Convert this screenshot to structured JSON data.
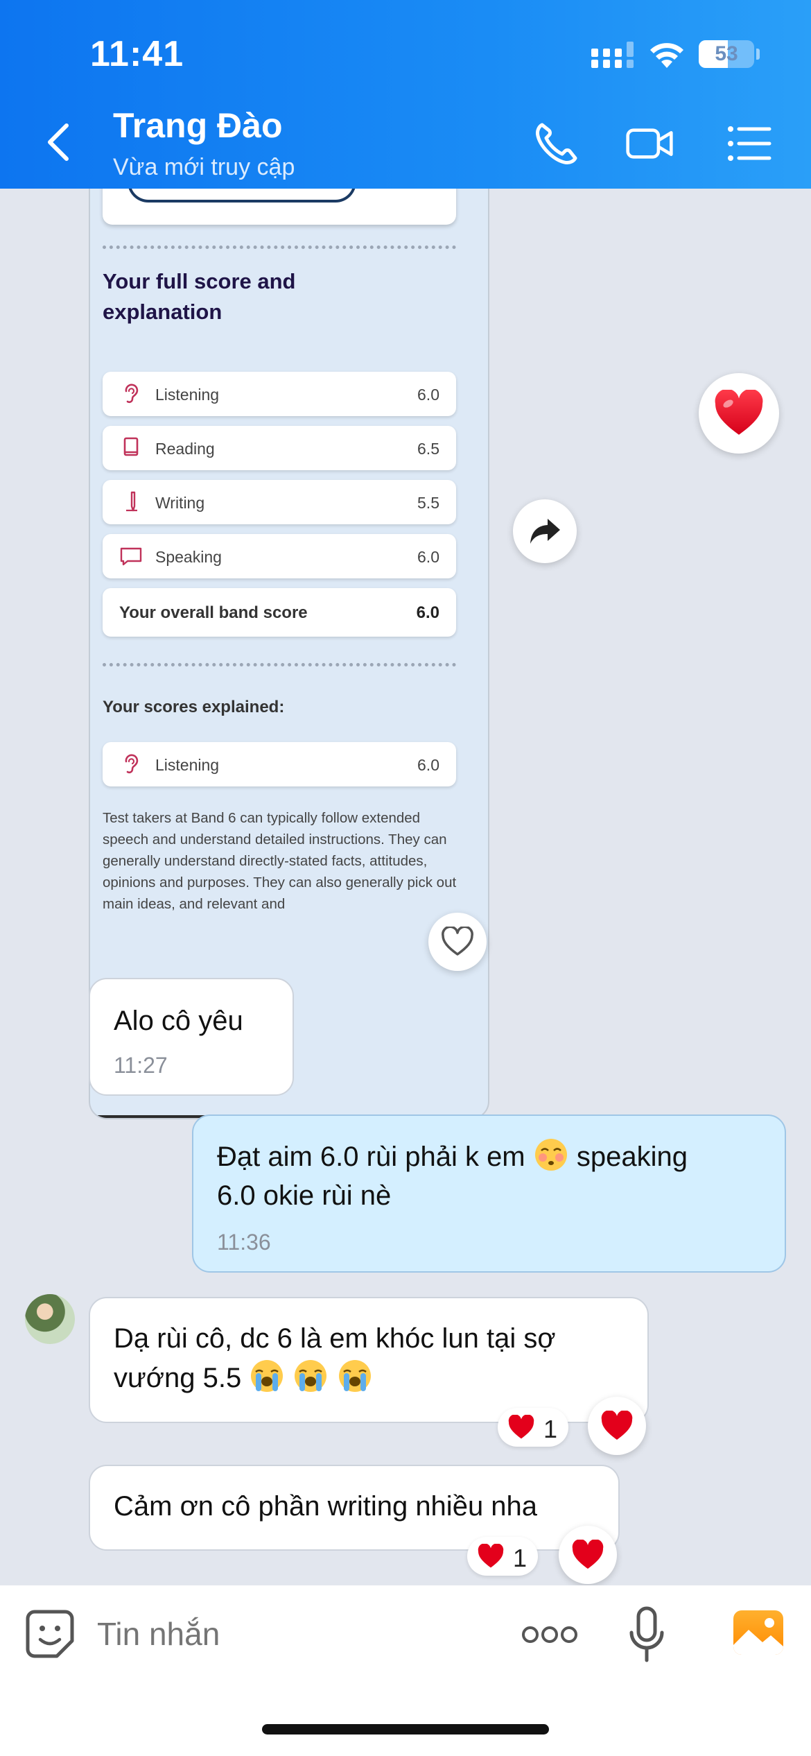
{
  "status_bar": {
    "time": "11:41",
    "battery": "53",
    "battery_percent": 53
  },
  "header": {
    "contact_name": "Trang Đào",
    "contact_status": "Vừa mới truy cập",
    "icons": [
      "back-icon",
      "phone-icon",
      "video-call-icon",
      "menu-list-icon"
    ]
  },
  "shared_image": {
    "section_title": "Your full score and explanation",
    "scores": [
      {
        "label": "Listening",
        "value": "6.0",
        "icon": "ear-icon"
      },
      {
        "label": "Reading",
        "value": "6.5",
        "icon": "book-icon"
      },
      {
        "label": "Writing",
        "value": "5.5",
        "icon": "pen-icon"
      },
      {
        "label": "Speaking",
        "value": "6.0",
        "icon": "speech-bubble-icon"
      }
    ],
    "overall": {
      "label": "Your overall band score",
      "value": "6.0"
    },
    "explained_title": "Your scores explained:",
    "explained_row": {
      "label": "Listening",
      "value": "6.0"
    },
    "explanation": "Test takers at Band 6 can typically follow extended speech and understand detailed instructions. They can generally understand directly-stated facts, attitudes, opinions and purposes. They can also generally pick out main ideas, and relevant and"
  },
  "messages": [
    {
      "sender": "other",
      "text": "Alo cô yêu",
      "time": "11:27"
    },
    {
      "sender": "me",
      "text_before": "Đạt aim 6.0 rùi phải k em",
      "emoji_1": "😳",
      "text_after": " speaking",
      "line2": "6.0 okie rùi nè",
      "time": "11:36"
    },
    {
      "sender": "other",
      "line1": "Dạ rùi cô, dc 6 là em khóc lun tại sợ",
      "line2": "vướng 5.5",
      "emojis": "😭😭😭",
      "reaction_count": "1"
    },
    {
      "sender": "other",
      "text": "Cảm ơn cô phần writing nhiều nha",
      "reaction_count": "1"
    }
  ],
  "input": {
    "placeholder": "Tin nhắn"
  },
  "colors": {
    "header": "#0d75f0",
    "my_bubble": "#d4efff",
    "heart": "#e3001b",
    "background": "#e2e6ee"
  }
}
